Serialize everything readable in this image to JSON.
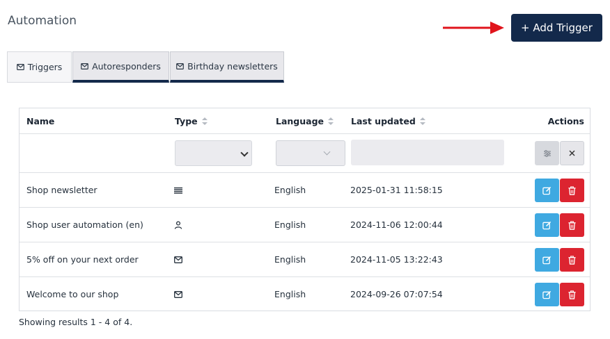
{
  "page": {
    "title": "Automation",
    "add_button": "+ Add Trigger",
    "colors": {
      "primary": "#13294b",
      "edit": "#3fa9e1",
      "delete": "#dc2430",
      "arrow": "#e0141c"
    }
  },
  "tabs": [
    {
      "label": "Triggers",
      "icon": "envelope-icon",
      "active": true
    },
    {
      "label": "Autoresponders",
      "icon": "envelope-icon",
      "active": false
    },
    {
      "label": "Birthday newsletters",
      "icon": "envelope-icon",
      "active": false
    }
  ],
  "table": {
    "columns": {
      "name": "Name",
      "type": "Type",
      "language": "Language",
      "updated": "Last updated",
      "actions": "Actions"
    },
    "rows": [
      {
        "name": "Shop newsletter",
        "type_icon": "list-icon",
        "language": "English",
        "updated": "2025-01-31 11:58:15"
      },
      {
        "name": "Shop user automation (en)",
        "type_icon": "user-icon",
        "language": "English",
        "updated": "2024-11-06 12:00:44"
      },
      {
        "name": "5% off on your next order",
        "type_icon": "envelope-icon",
        "language": "English",
        "updated": "2024-11-05 13:22:43"
      },
      {
        "name": "Welcome to our shop",
        "type_icon": "envelope-icon",
        "language": "English",
        "updated": "2024-09-26 07:07:54"
      }
    ]
  },
  "footer": {
    "summary": "Showing results 1 - 4 of 4."
  }
}
